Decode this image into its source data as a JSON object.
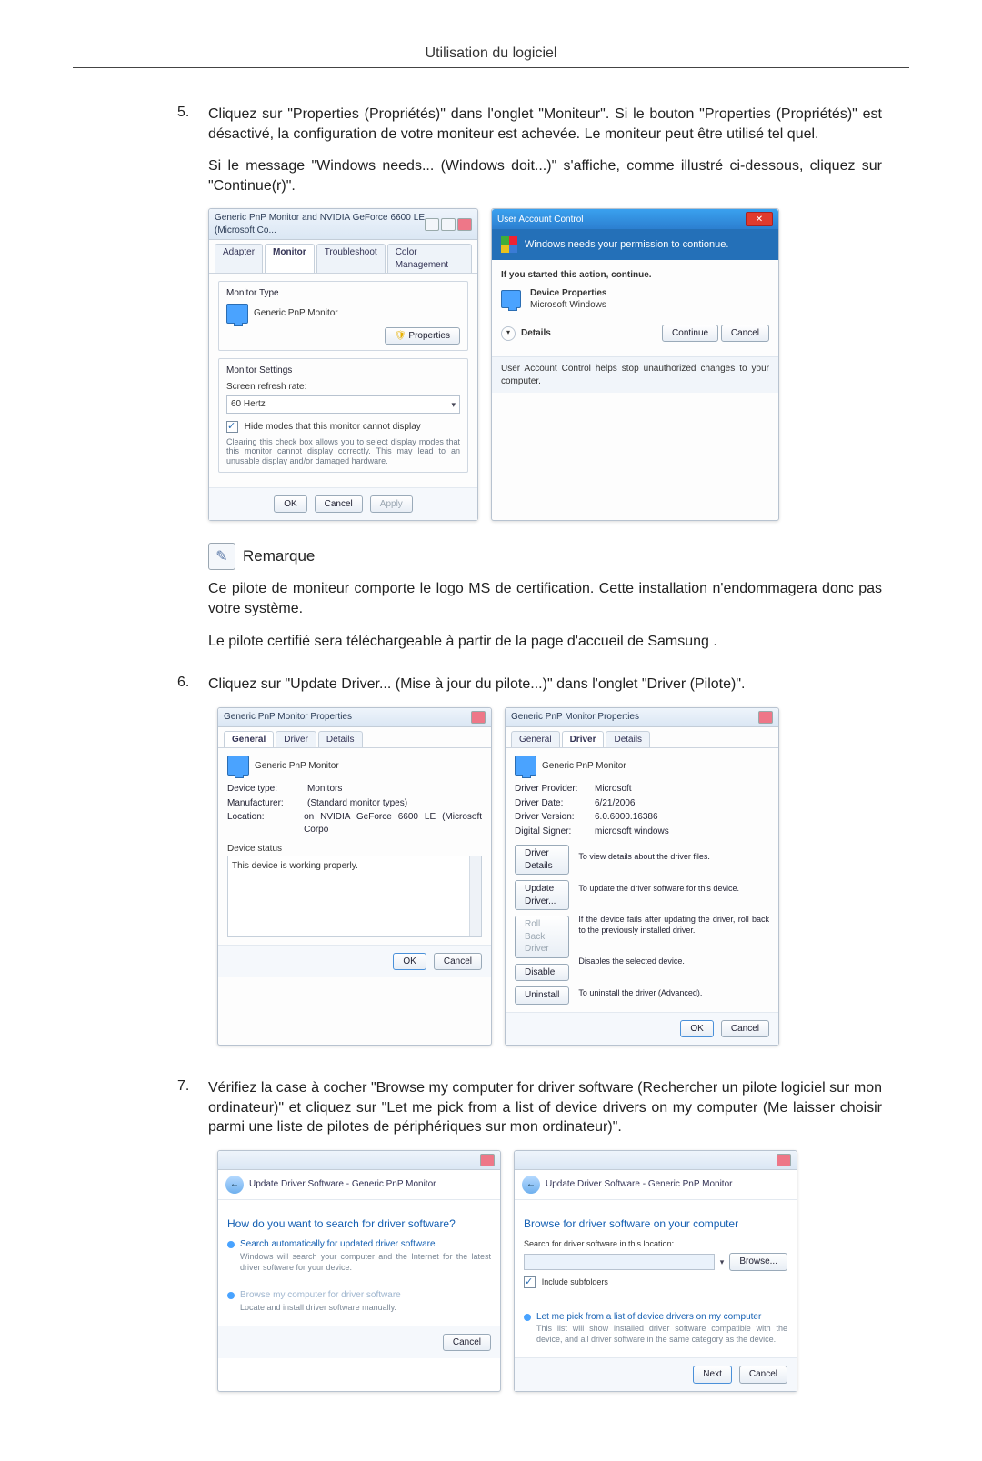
{
  "page": {
    "header": "Utilisation du logiciel"
  },
  "step5": {
    "num": "5.",
    "p1": "Cliquez sur \"Properties (Propriétés)\" dans l'onglet \"Moniteur\". Si le bouton \"Properties (Propriétés)\" est désactivé, la configuration de votre moniteur est achevée. Le moniteur peut être utilisé tel quel.",
    "p2": "Si le message \"Windows needs... (Windows doit...)\" s'affiche, comme illustré ci-dessous, cliquez sur \"Continue(r)\"."
  },
  "monitorDlg": {
    "title": "Generic PnP Monitor and NVIDIA GeForce 6600 LE (Microsoft Co...",
    "tabs": {
      "adapter": "Adapter",
      "monitor": "Monitor",
      "troubleshoot": "Troubleshoot",
      "color": "Color Management"
    },
    "monitorType": {
      "group": "Monitor Type",
      "name": "Generic PnP Monitor",
      "propsBtn": "Properties"
    },
    "settings": {
      "group": "Monitor Settings",
      "refreshLabel": "Screen refresh rate:",
      "refreshValue": "60 Hertz",
      "hideModes": "Hide modes that this monitor cannot display",
      "hideDesc": "Clearing this check box allows you to select display modes that this monitor cannot display correctly. This may lead to an unusable display and/or damaged hardware."
    },
    "footer": {
      "ok": "OK",
      "cancel": "Cancel",
      "apply": "Apply"
    }
  },
  "uac": {
    "title": "User Account Control",
    "bar": "Windows needs your permission to contionue.",
    "ifStarted": "If you started this action, continue.",
    "prog": "Device Properties",
    "vendor": "Microsoft Windows",
    "details": "Details",
    "continue": "Continue",
    "cancel": "Cancel",
    "foot": "User Account Control helps stop unauthorized changes to your computer."
  },
  "remark": {
    "title": "Remarque",
    "p1": "Ce pilote de moniteur comporte le logo MS de certification. Cette installation n'endommagera donc pas votre système.",
    "p2": "Le pilote certifié sera téléchargeable à partir de la page d'accueil de Samsung ."
  },
  "step6": {
    "num": "6.",
    "p1": "Cliquez sur \"Update Driver... (Mise à jour du pilote...)\" dans l'onglet \"Driver (Pilote)\"."
  },
  "propGeneral": {
    "title": "Generic PnP Monitor Properties",
    "tabs": {
      "general": "General",
      "driver": "Driver",
      "details": "Details"
    },
    "name": "Generic PnP Monitor",
    "devType": {
      "k": "Device type:",
      "v": "Monitors"
    },
    "manuf": {
      "k": "Manufacturer:",
      "v": "(Standard monitor types)"
    },
    "loc": {
      "k": "Location:",
      "v": "on NVIDIA GeForce 6600 LE (Microsoft Corpo"
    },
    "statusLabel": "Device status",
    "statusText": "This device is working properly.",
    "ok": "OK",
    "cancel": "Cancel"
  },
  "propDriver": {
    "title": "Generic PnP Monitor Properties",
    "name": "Generic PnP Monitor",
    "provider": {
      "k": "Driver Provider:",
      "v": "Microsoft"
    },
    "date": {
      "k": "Driver Date:",
      "v": "6/21/2006"
    },
    "version": {
      "k": "Driver Version:",
      "v": "6.0.6000.16386"
    },
    "signer": {
      "k": "Digital Signer:",
      "v": "microsoft windows"
    },
    "btns": {
      "details": "Driver Details",
      "detailsDesc": "To view details about the driver files.",
      "update": "Update Driver...",
      "updateDesc": "To update the driver software for this device.",
      "rollback": "Roll Back Driver",
      "rollbackDesc": "If the device fails after updating the driver, roll back to the previously installed driver.",
      "disable": "Disable",
      "disableDesc": "Disables the selected device.",
      "uninstall": "Uninstall",
      "uninstallDesc": "To uninstall the driver (Advanced)."
    },
    "ok": "OK",
    "cancel": "Cancel"
  },
  "step7": {
    "num": "7.",
    "p1": "Vérifiez la case à cocher \"Browse my computer for driver software (Rechercher un pilote logiciel sur mon ordinateur)\" et cliquez sur \"Let me pick from a list of device drivers on my computer (Me laisser choisir parmi une liste de pilotes de périphériques sur mon ordinateur)\"."
  },
  "wiz1": {
    "crumb": "Update Driver Software - Generic PnP Monitor",
    "h": "How do you want to search for driver software?",
    "opt1t": "Search automatically for updated driver software",
    "opt1d": "Windows will search your computer and the Internet for the latest driver software for your device.",
    "opt2t": "Browse my computer for driver software",
    "opt2d": "Locate and install driver software manually.",
    "cancel": "Cancel"
  },
  "wiz2": {
    "crumb": "Update Driver Software - Generic PnP Monitor",
    "h": "Browse for driver software on your computer",
    "searchLabel": "Search for driver software in this location:",
    "browse": "Browse...",
    "include": "Include subfolders",
    "pick": "Let me pick from a list of device drivers on my computer",
    "pickd": "This list will show installed driver software compatible with the device, and all driver software in the same category as the device.",
    "next": "Next",
    "cancel": "Cancel"
  }
}
